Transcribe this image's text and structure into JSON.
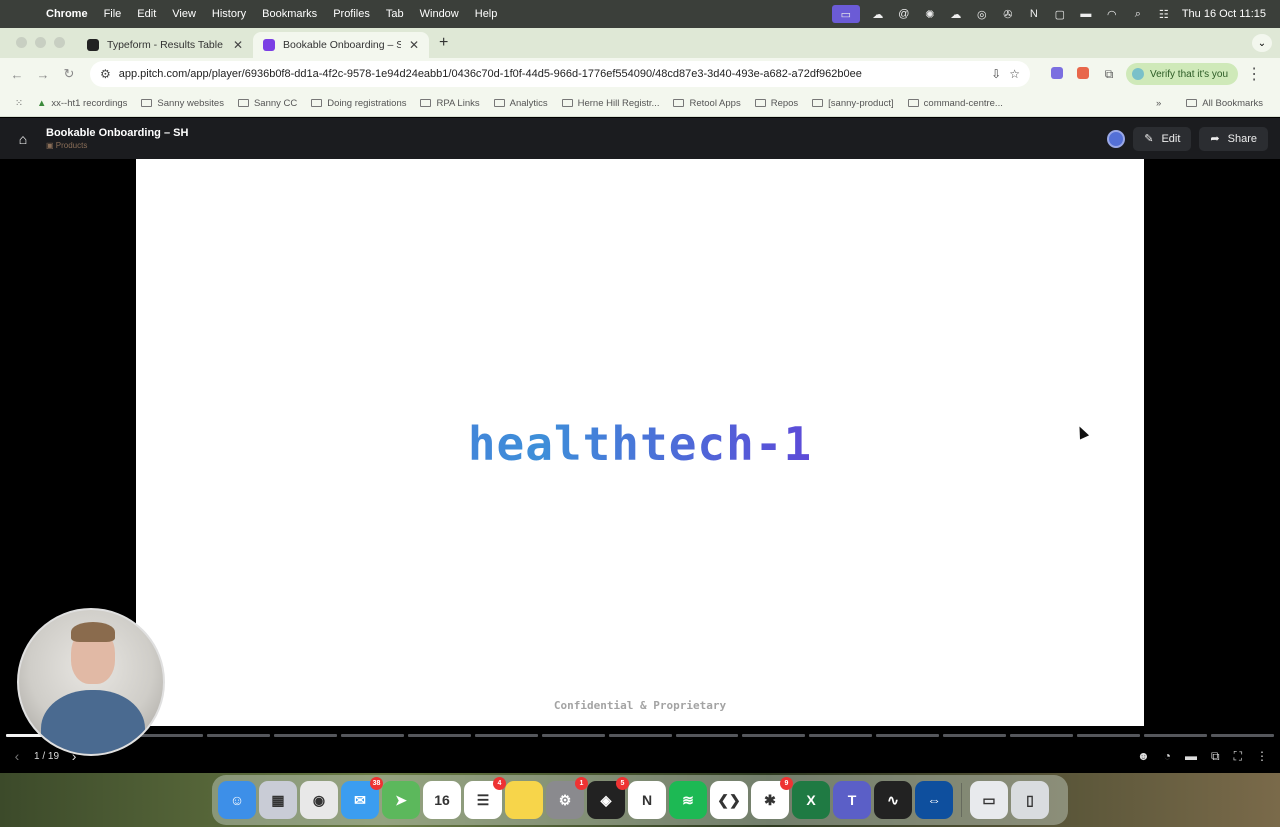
{
  "menubar": {
    "app_name": "Chrome",
    "items": [
      "File",
      "Edit",
      "View",
      "History",
      "Bookmarks",
      "Profiles",
      "Tab",
      "Window",
      "Help"
    ],
    "clock": "Thu 16 Oct  11:15"
  },
  "tabs": [
    {
      "title": "Typeform - Results Table",
      "favicon_color": "#222222",
      "active": false
    },
    {
      "title": "Bookable Onboarding – SH",
      "favicon_color": "#7b3fe4",
      "active": true
    }
  ],
  "toolbar": {
    "url": "app.pitch.com/app/player/6936b0f8-dd1a-4f2c-9578-1e94d24eabb1/0436c70d-1f0f-44d5-966d-1776ef554090/48cd87e3-3d40-493e-a682-a72df962b0ee",
    "verify_label": "Verify that it's you"
  },
  "bookmarks": {
    "items": [
      "xx--ht1 recordings",
      "Sanny websites",
      "Sanny CC",
      "Doing registrations",
      "RPA Links",
      "Analytics",
      "Herne Hill Registr...",
      "Retool Apps",
      "Repos",
      "[sanny-product]",
      "command-centre..."
    ],
    "all_label": "All Bookmarks"
  },
  "player": {
    "doc_title": "Bookable Onboarding – SH",
    "doc_subtitle": "Products",
    "edit_label": "Edit",
    "share_label": "Share"
  },
  "slide": {
    "title": "healthtech-1",
    "footer": "Confidential & Proprietary",
    "gradient_colors": [
      "#5b5bd9",
      "#3e8fd9",
      "#5a4fd8",
      "#9b12d8"
    ]
  },
  "pager": {
    "current": 1,
    "total": 19,
    "label": "1 / 19"
  },
  "dock": {
    "apps": [
      {
        "name": "finder-icon",
        "color": "#3d8fe8",
        "glyph": "☺",
        "badge": ""
      },
      {
        "name": "launchpad-icon",
        "color": "#c9ccd6",
        "glyph": "▦",
        "badge": ""
      },
      {
        "name": "chrome-icon",
        "color": "#e8e8e8",
        "glyph": "◉",
        "badge": ""
      },
      {
        "name": "mail-icon",
        "color": "#3b9df0",
        "glyph": "✉",
        "badge": "38"
      },
      {
        "name": "maps-icon",
        "color": "#5cb85c",
        "glyph": "➤",
        "badge": ""
      },
      {
        "name": "calendar-icon",
        "color": "#ffffff",
        "glyph": "16",
        "badge": ""
      },
      {
        "name": "reminders-icon",
        "color": "#ffffff",
        "glyph": "☰",
        "badge": "4"
      },
      {
        "name": "notes-icon",
        "color": "#f7d54a",
        "glyph": "",
        "badge": ""
      },
      {
        "name": "settings-icon",
        "color": "#8a8a8e",
        "glyph": "⚙",
        "badge": "1"
      },
      {
        "name": "linear-icon",
        "color": "#222222",
        "glyph": "◈",
        "badge": "5"
      },
      {
        "name": "notion-icon",
        "color": "#ffffff",
        "glyph": "N",
        "badge": ""
      },
      {
        "name": "spotify-icon",
        "color": "#1db954",
        "glyph": "≋",
        "badge": ""
      },
      {
        "name": "vscode-icon",
        "color": "#ffffff",
        "glyph": "❮❯",
        "badge": ""
      },
      {
        "name": "slack-icon",
        "color": "#ffffff",
        "glyph": "✱",
        "badge": "9"
      },
      {
        "name": "excel-icon",
        "color": "#1f7a43",
        "glyph": "X",
        "badge": ""
      },
      {
        "name": "teams-icon",
        "color": "#5b5fc7",
        "glyph": "T",
        "badge": ""
      },
      {
        "name": "audio-icon",
        "color": "#222222",
        "glyph": "∿",
        "badge": ""
      },
      {
        "name": "teamviewer-icon",
        "color": "#0e4f9e",
        "glyph": "⇔",
        "badge": ""
      },
      {
        "name": "downloads-icon",
        "color": "#e8eaed",
        "glyph": "▭",
        "badge": ""
      },
      {
        "name": "trash-icon",
        "color": "#d9dcdf",
        "glyph": "▯",
        "badge": ""
      }
    ]
  }
}
